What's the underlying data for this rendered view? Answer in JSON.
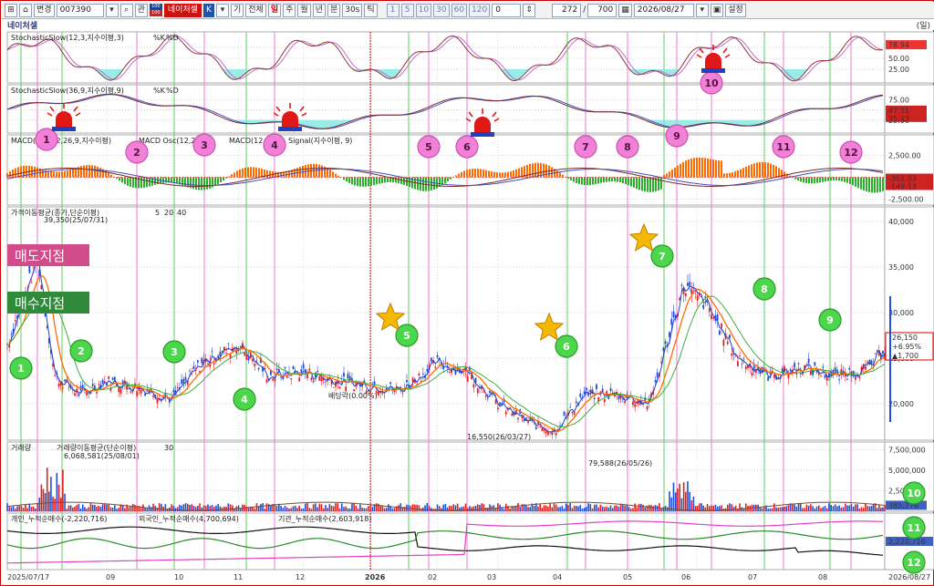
{
  "toolbar": {
    "change_label": "변경",
    "code": "007390",
    "gwan_label": "관",
    "badge_top": "100 KRX",
    "badge_bottom": "100 NXT",
    "stock_tab": "네이처셀",
    "k_label": "K",
    "periods": [
      "기",
      "전체",
      "일",
      "주",
      "월",
      "년",
      "분",
      "30s",
      "틱"
    ],
    "numbers": [
      "1",
      "5",
      "10",
      "30",
      "60",
      "120",
      "0"
    ],
    "count": "272",
    "total": "700",
    "date": "2026/08/27",
    "settings_label": "설정"
  },
  "chart_title": "네이처셀",
  "unit": "(일)",
  "colors": {
    "up": "#e02020",
    "down": "#1f4fd8",
    "buy_line": "#5ad05a",
    "sell_line": "#f07ad0",
    "red_line": "#c00000"
  },
  "panels": {
    "stoch1": {
      "label": "StochasticSlow(12,3,지수이평,3)",
      "k": "%K",
      "d": "%D",
      "ticks": [
        "78.94",
        "50.00",
        "25.00"
      ],
      "value_box": "78.94"
    },
    "stoch2": {
      "label": "StochasticSlow(36,9,지수이평,9)",
      "k": "%K",
      "d": "%D",
      "ticks": [
        "75.00",
        "50.00",
        "25.00"
      ],
      "value_box1": "47.31",
      "value_box2": "35.43"
    },
    "macd": {
      "label": "MACD(지수,12,26,9,지수이평)",
      "osc": "MACD Osc(12,26,9)",
      "macd": "MACD(12,26)",
      "signal": "Signal(지수이평, 9)",
      "ticks": [
        "2,500.00",
        "0.00",
        "-2,500.00"
      ],
      "value_box1": "-361.03",
      "value_box2": "-149.13"
    },
    "price": {
      "label": "가격이동평균(종가,단순이평)",
      "ma": [
        "5",
        "20",
        "40"
      ],
      "ticks": [
        "40,000",
        "35,000",
        "30,000",
        "25,000",
        "20,000"
      ],
      "high_note": "39,350(25/07/31)",
      "low_note": "16,550(26/03/27)",
      "dividend_note": "배당락(0.00%)",
      "last_price": "26,150",
      "change_pct": "+6.95%",
      "change_amt": "▲1,700"
    },
    "volume": {
      "label": "거래량",
      "ma_label": "거래량이동평균(단순이평)",
      "ma": "30",
      "ticks": [
        "7,500,000",
        "5,000,000",
        "2,500,000"
      ],
      "peak_note": "79,588(26/05/26)",
      "left_note": "6,068,581(25/08/01)",
      "value_box": "385,276"
    },
    "investors": {
      "individual": "개인_누적순매수(-2,220,716)",
      "foreign": "외국인_누적순매수(4,700,694)",
      "institution": "기관_누적순매수(2,603,918)",
      "value_box": "2,220,716"
    }
  },
  "overlay": {
    "sell_point": "매도지점",
    "buy_point": "매수지점"
  },
  "dates": [
    "2025/07/17",
    "09",
    "10",
    "11",
    "12",
    "2026",
    "02",
    "03",
    "04",
    "05",
    "06",
    "07",
    "08",
    "2026/08/27"
  ],
  "chart_data": {
    "type": "candlestick",
    "title": "네이처셀",
    "x": [
      "2025-07-17",
      "2025-07-31",
      "2025-08-08",
      "2025-08-20",
      "2025-09-01",
      "2025-09-15",
      "2025-10-01",
      "2025-10-15",
      "2025-11-01",
      "2025-11-15",
      "2025-12-01",
      "2025-12-15",
      "2026-01-01",
      "2026-01-15",
      "2026-02-01",
      "2026-02-15",
      "2026-03-01",
      "2026-03-15",
      "2026-03-27",
      "2026-04-10",
      "2026-04-25",
      "2026-05-10",
      "2026-05-26",
      "2026-06-05",
      "2026-06-20",
      "2026-07-05",
      "2026-07-20",
      "2026-08-05",
      "2026-08-20",
      "2026-08-27"
    ],
    "close": [
      26500,
      36000,
      23000,
      21000,
      22500,
      21800,
      20500,
      24500,
      26500,
      23000,
      23500,
      22500,
      22000,
      21500,
      24500,
      23500,
      20000,
      18000,
      17000,
      21000,
      21000,
      20000,
      33000,
      31000,
      25000,
      23000,
      24000,
      23000,
      24000,
      26150
    ],
    "ylim": [
      16000,
      41000
    ],
    "annotations": {
      "high": "39,350(25/07/31)",
      "low": "16,550(26/03/27)"
    },
    "signals_buy": [
      "1",
      "2",
      "3",
      "4",
      "5",
      "6",
      "7",
      "8",
      "9"
    ],
    "signals_sell": [
      "1",
      "2",
      "3",
      "4",
      "5",
      "6",
      "7",
      "8",
      "9",
      "10",
      "11",
      "12"
    ],
    "moving_averages": [
      "5",
      "20",
      "40"
    ]
  }
}
